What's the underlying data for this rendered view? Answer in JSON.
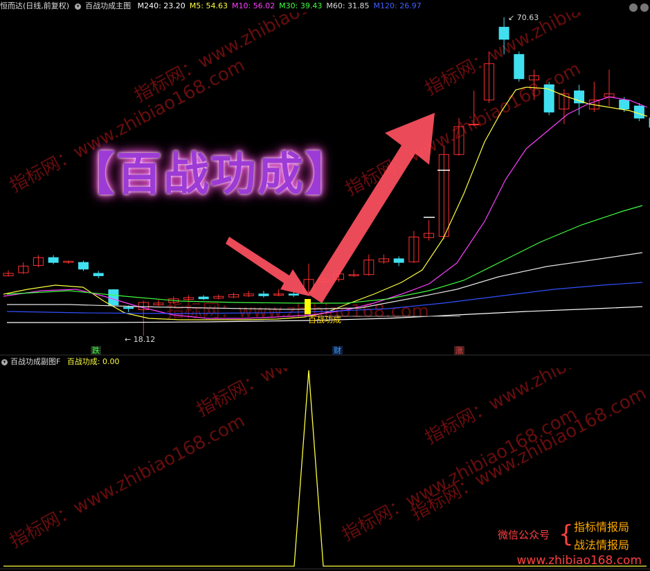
{
  "header": {
    "stock_name": "恒而达(日线,前复权)",
    "indicator_name": "百战功成主图",
    "ma": [
      {
        "label": "M240: 23.20",
        "color": "#ffffff"
      },
      {
        "label": "M5: 54.63",
        "color": "#ffff40"
      },
      {
        "label": "M10: 56.02",
        "color": "#ff40ff"
      },
      {
        "label": "M30: 39.43",
        "color": "#40ff40"
      },
      {
        "label": "M60: 31.85",
        "color": "#dddddd"
      },
      {
        "label": "M120: 26.97",
        "color": "#4060ff"
      }
    ]
  },
  "main_chart": {
    "title_overlay": "【百战功成】",
    "high_marker": "70.63",
    "low_marker": "18.12",
    "signal_label": "百战功成",
    "day_tags": [
      {
        "label": "跌",
        "color": "#40ff40",
        "bg": "#203020"
      },
      {
        "label": "财",
        "color": "#40a0ff",
        "bg": "#102040"
      },
      {
        "label": "涨",
        "color": "#ff4040",
        "bg": "#402020"
      }
    ],
    "watermark": "指标网：www.zhibiao168.com"
  },
  "sub_chart": {
    "name": "百战功成副图F",
    "value_label": "百战功成: 0.00"
  },
  "promo": {
    "label": "微信公众号",
    "line1": "指标情报局",
    "line2": "战法情报局",
    "url": "www.zhibiao168.com"
  },
  "colors": {
    "up": "#ff3030",
    "down": "#40e0f0",
    "arrow": "#ff5060",
    "signal": "#ffff00"
  }
}
